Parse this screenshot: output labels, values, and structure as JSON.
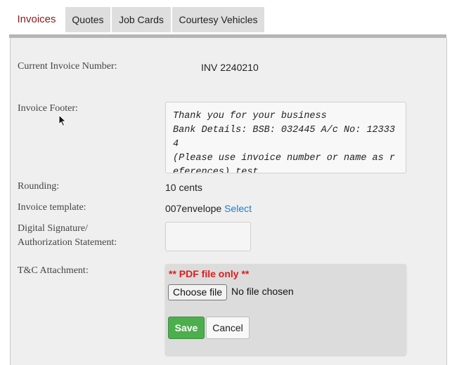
{
  "tabs": [
    {
      "label": "Invoices",
      "active": true
    },
    {
      "label": "Quotes",
      "active": false
    },
    {
      "label": "Job Cards",
      "active": false
    },
    {
      "label": "Courtesy Vehicles",
      "active": false
    }
  ],
  "form": {
    "current_invoice_label": "Current Invoice Number:",
    "current_invoice_value": "INV 2240210",
    "footer_label": "Invoice Footer:",
    "footer_value": "Thank you for your business\nBank Details: BSB: 032445 A/c No: 123334\n(Please use invoice number or name as references) test",
    "rounding_label": "Rounding:",
    "rounding_value": "10 cents",
    "template_label": "Invoice template:",
    "template_value": "007envelope",
    "template_select_link": "Select",
    "signature_label_line1": "Digital Signature/",
    "signature_label_line2": "Authorization Statement:",
    "signature_value": "",
    "tc_label": "T&C Attachment:",
    "pdf_note": "** PDF file only **",
    "choose_file_label": "Choose file",
    "file_status": "No file chosen",
    "save_label": "Save",
    "cancel_label": "Cancel"
  },
  "colors": {
    "active_tab_text": "#8b1a1a",
    "tab_bg": "#dedede",
    "panel_bg": "#efefef",
    "link": "#1a7fd4",
    "pdf_note": "#e01b1b",
    "save_bg": "#4cae4c"
  }
}
